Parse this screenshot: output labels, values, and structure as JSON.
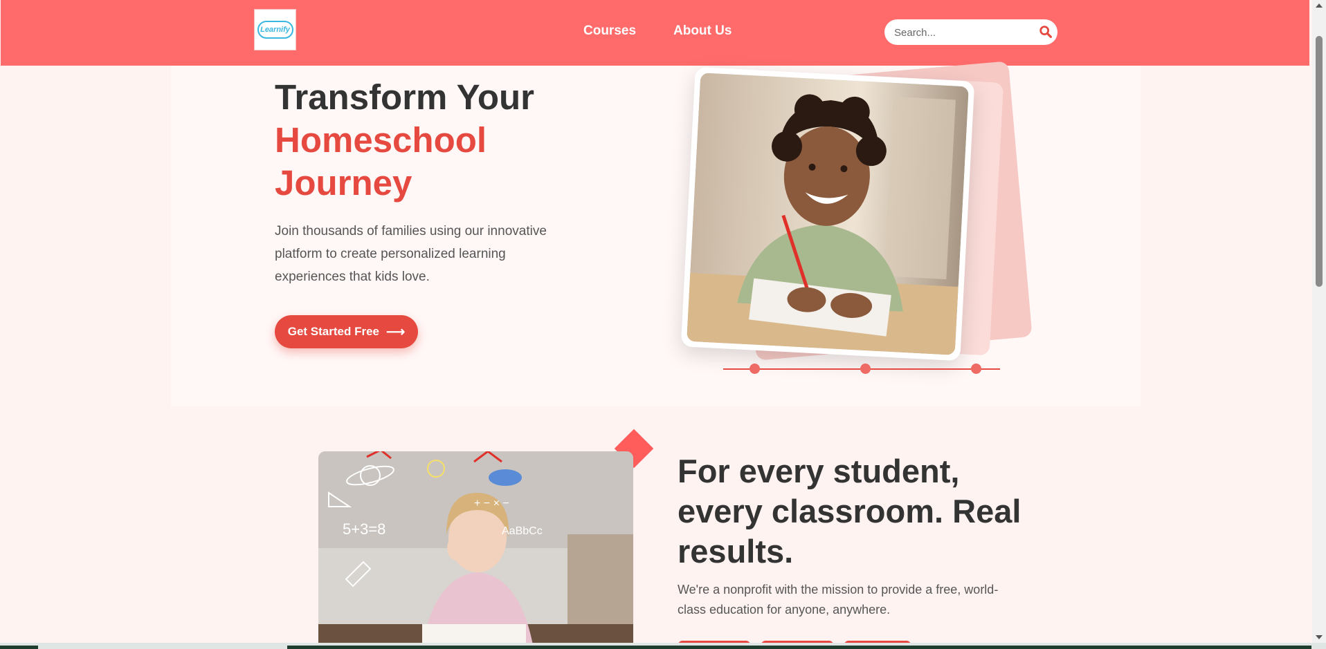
{
  "header": {
    "logo_text": "Learnify",
    "nav": [
      {
        "label": "Courses"
      },
      {
        "label": "About Us"
      }
    ],
    "search": {
      "placeholder": "Search..."
    }
  },
  "hero": {
    "title_line1": "Transform Your",
    "title_line2": "Homeschool",
    "title_line3": "Journey",
    "subtitle": "Join thousands of families using our innovative platform to create personalized learning experiences that kids love.",
    "cta_label": "Get Started Free",
    "cta_arrow": "⟶",
    "slider_dots": 3
  },
  "mission": {
    "title": "For every student, every classroom. Real results.",
    "text": "We're a nonprofit with the mission to provide a free, world-class education for anyone, anywhere.",
    "math_doodle": "5+3=8",
    "alphabet_doodle": "AaBbCc",
    "ops_doodle": "+ − × −"
  },
  "colors": {
    "header_bg": "#ff6b6b",
    "accent": "#e5493f",
    "page_bg": "#fff3f2"
  },
  "icons": {
    "search": "search-icon"
  }
}
